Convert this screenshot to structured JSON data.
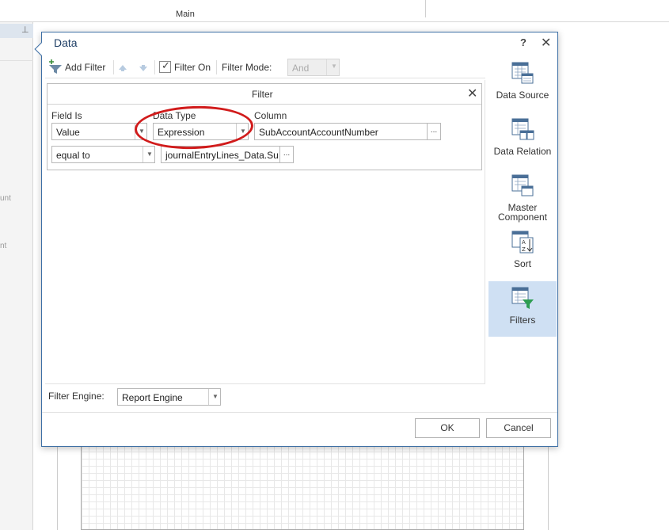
{
  "background": {
    "tab_main": "Main",
    "left_panel_texts": [
      "unt",
      "nt"
    ]
  },
  "dialog": {
    "title": "Data",
    "help_label": "?",
    "close_label": "✕",
    "toolbar": {
      "add_filter_label": "Add Filter",
      "filter_on_label": "Filter On",
      "filter_on_checked": true,
      "filter_mode_label": "Filter Mode:",
      "filter_mode_value": "And"
    },
    "filter_panel": {
      "header_title": "Filter",
      "close_label": "✕",
      "field_is_label": "Field Is",
      "data_type_label": "Data Type",
      "column_label": "Column",
      "field_is_value": "Value",
      "data_type_value": "Expression",
      "column_value": "SubAccountAccountNumber",
      "condition_value": "equal to",
      "expression_value": "journalEntryLines_Data.Su",
      "ellipsis": "..."
    },
    "filter_engine_label": "Filter Engine:",
    "filter_engine_value": "Report Engine",
    "side_items": [
      {
        "label": "Data Source",
        "icon": "data-source-icon",
        "active": false
      },
      {
        "label": "Data Relation",
        "icon": "data-relation-icon",
        "active": false
      },
      {
        "label": "Master Component",
        "icon": "master-component-icon",
        "active": false
      },
      {
        "label": "Sort",
        "icon": "sort-icon",
        "active": false
      },
      {
        "label": "Filters",
        "icon": "filters-icon",
        "active": true
      }
    ],
    "ok_label": "OK",
    "cancel_label": "Cancel"
  },
  "colors": {
    "dialog_border": "#3d6fa5",
    "active_side_item": "#cfe0f3",
    "annotation_red": "#d11b1b",
    "filter_funnel": "#2e9e52"
  }
}
